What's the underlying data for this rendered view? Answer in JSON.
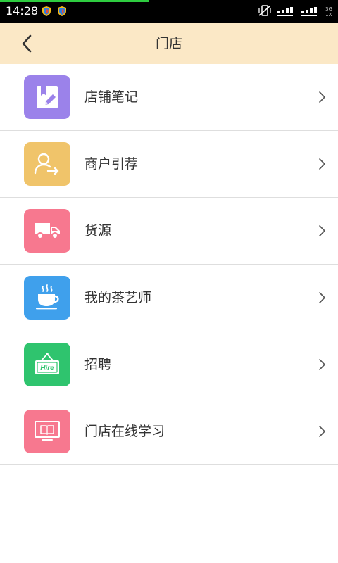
{
  "status_bar": {
    "time": "14:28",
    "network_top": "3G",
    "network_bottom": "1X",
    "progress_fraction": 0.44,
    "icons": [
      "shield-app-icon",
      "shield-app-icon",
      "vibrate-off-icon",
      "signal-icon",
      "signal-icon"
    ]
  },
  "header": {
    "title": "门店",
    "back_icon": "chevron-left-icon",
    "background": "#fbe8c6"
  },
  "menu": [
    {
      "label": "店铺笔记",
      "icon": "notebook-pen-icon",
      "color": "#9b82ea"
    },
    {
      "label": "商户引荐",
      "icon": "user-referral-icon",
      "color": "#f0c46a"
    },
    {
      "label": "货源",
      "icon": "delivery-truck-icon",
      "color": "#f7788f"
    },
    {
      "label": "我的茶艺师",
      "icon": "hot-tea-cup-icon",
      "color": "#3fa0ec"
    },
    {
      "label": "招聘",
      "icon": "hire-sign-icon",
      "icon_text": "Hire",
      "color": "#2fc46e"
    },
    {
      "label": "门店在线学习",
      "icon": "online-learning-monitor-icon",
      "color": "#f7788f"
    }
  ]
}
